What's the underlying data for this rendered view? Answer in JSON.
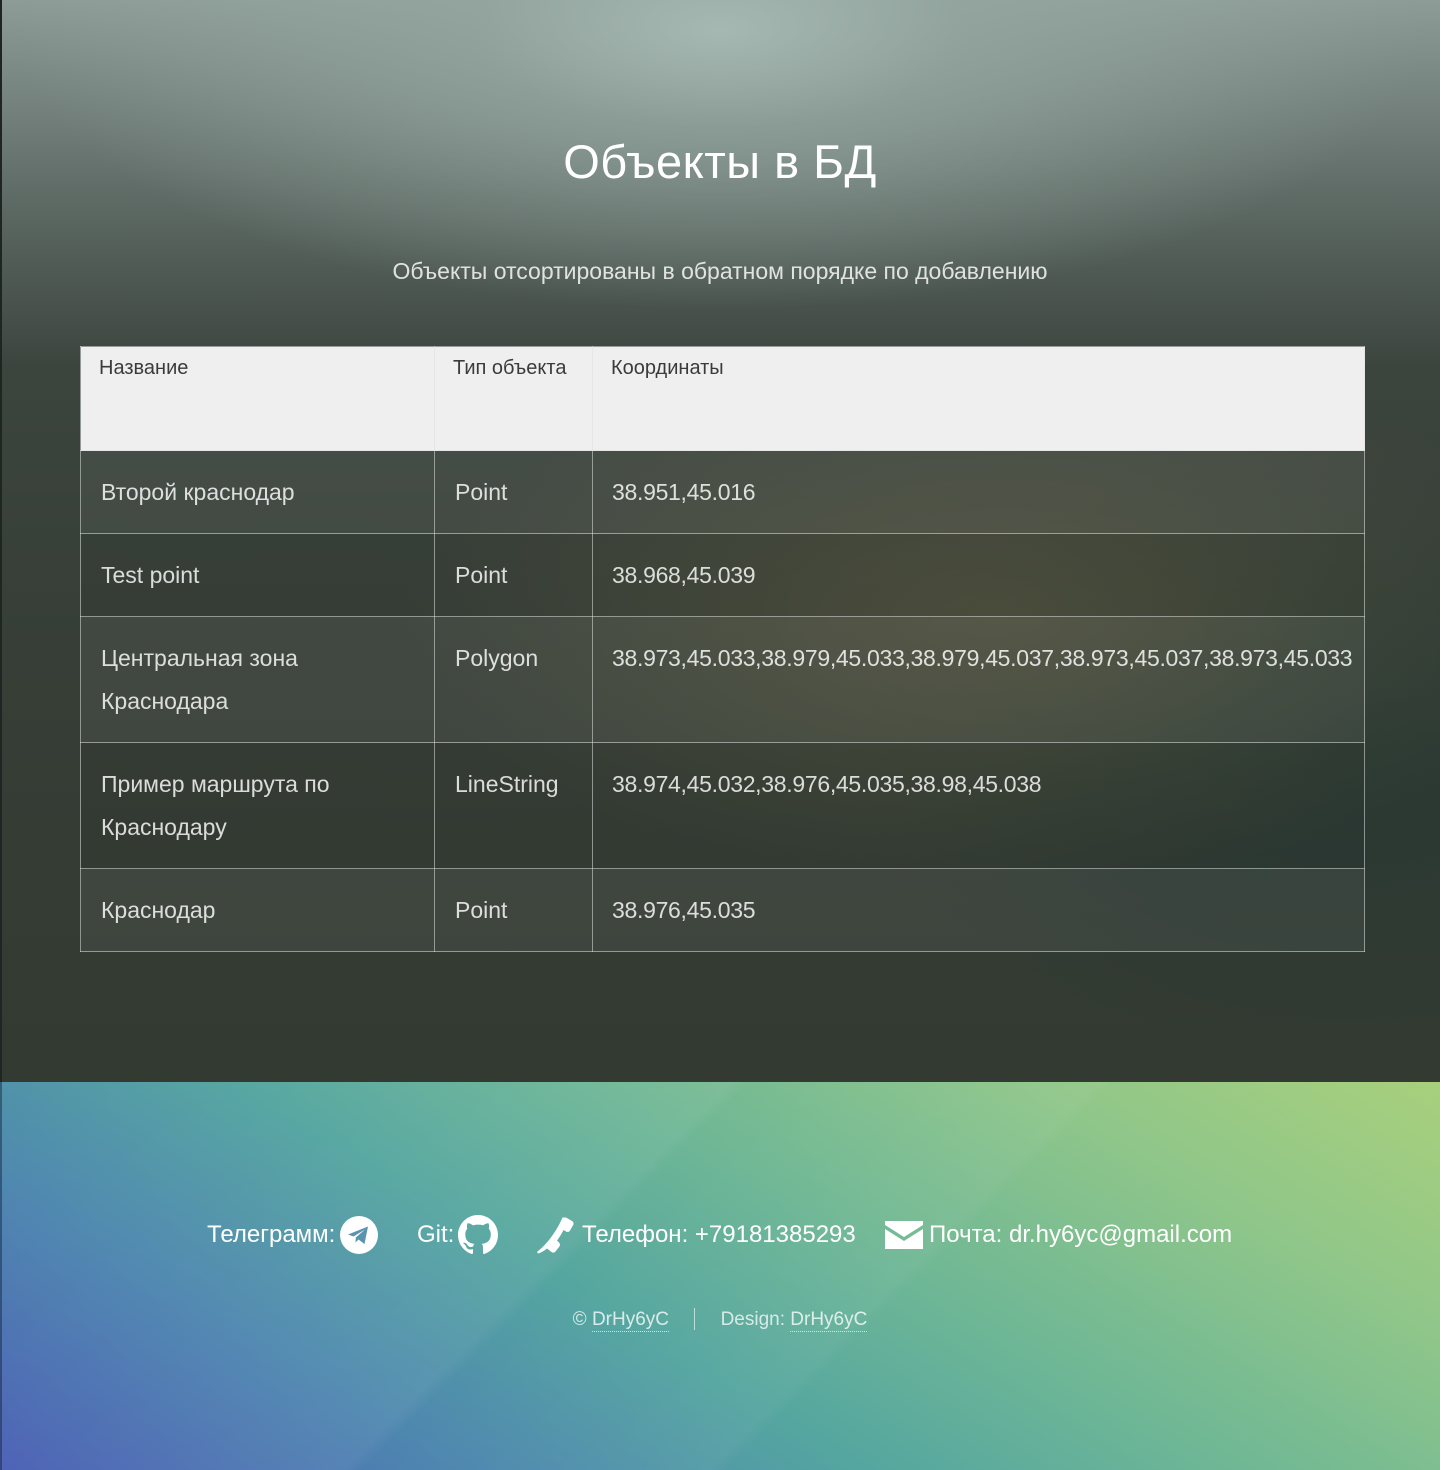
{
  "header": {
    "title": "Объекты в БД",
    "subtitle": "Объекты отсортированы в обратном порядке по добавлению"
  },
  "table": {
    "columns": [
      "Название",
      "Тип объекта",
      "Координаты"
    ],
    "rows": [
      {
        "name": "Второй краснодар",
        "type": "Point",
        "coords": "38.951,45.016"
      },
      {
        "name": "Test point",
        "type": "Point",
        "coords": "38.968,45.039"
      },
      {
        "name": "Центральная зона Краснодара",
        "type": "Polygon",
        "coords": "38.973,45.033,38.979,45.033,38.979,45.037,38.973,45.037,38.973,45.033"
      },
      {
        "name": "Пример маршрута по Краснодару",
        "type": "LineString",
        "coords": "38.974,45.032,38.976,45.035,38.98,45.038"
      },
      {
        "name": "Краснодар",
        "type": "Point",
        "coords": "38.976,45.035"
      }
    ]
  },
  "footer": {
    "telegram_label": "Телеграмм:",
    "telegram_icon": "telegram-icon",
    "git_label": "Git:",
    "git_icon": "github-icon",
    "phone_icon": "phone-icon",
    "phone_label": "Телефон: +79181385293",
    "mail_icon": "envelope-icon",
    "mail_label": "Почта: dr.hy6yc@gmail.com",
    "copyright_symbol": "©",
    "copyright_author": "DrHy6yC",
    "design_label": "Design:",
    "design_author": "DrHy6yC"
  },
  "colors": {
    "table_header_bg": "#efefef",
    "footer_gradient_start": "#4a5fb4",
    "footer_gradient_end": "#a8d07c"
  }
}
